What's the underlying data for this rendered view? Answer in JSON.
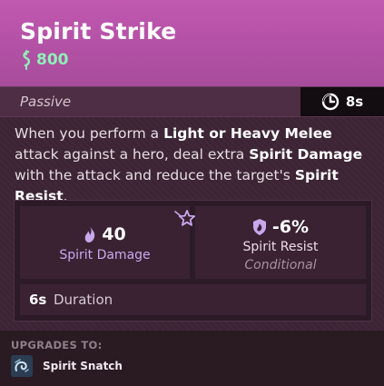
{
  "item": {
    "title": "Spirit Strike",
    "cost": "800",
    "type_label": "Passive",
    "cooldown": "8s",
    "description": {
      "t1": "When you perform a ",
      "b1": "Light or Heavy Melee",
      "t2": " attack against a hero, deal extra ",
      "b2": "Spirit Damage",
      "t3": " with the attack and reduce the target's ",
      "b3": "Spirit Resist",
      "t4": "."
    }
  },
  "stats": {
    "primary": {
      "value": "40",
      "label": "Spirit Damage"
    },
    "secondary": {
      "value": "-6%",
      "label": "Spirit Resist",
      "note": "Conditional"
    },
    "duration": {
      "value": "6s",
      "label": "Duration"
    }
  },
  "upgrades": {
    "heading": "UPGRADES TO:",
    "items": [
      {
        "name": "Spirit Snatch"
      }
    ]
  },
  "colors": {
    "header": "#b852a8",
    "cost": "#8ff0b6",
    "spirit": "#c9a8ec",
    "panel": "#3c2434"
  },
  "icons": {
    "currency": "souls-icon",
    "cooldown": "cooldown-clock-icon",
    "spirit": "spirit-flame-icon",
    "conditional": "conditional-star-icon",
    "resist": "spirit-resist-shield-icon",
    "upgrade": "spirit-snatch-icon"
  }
}
